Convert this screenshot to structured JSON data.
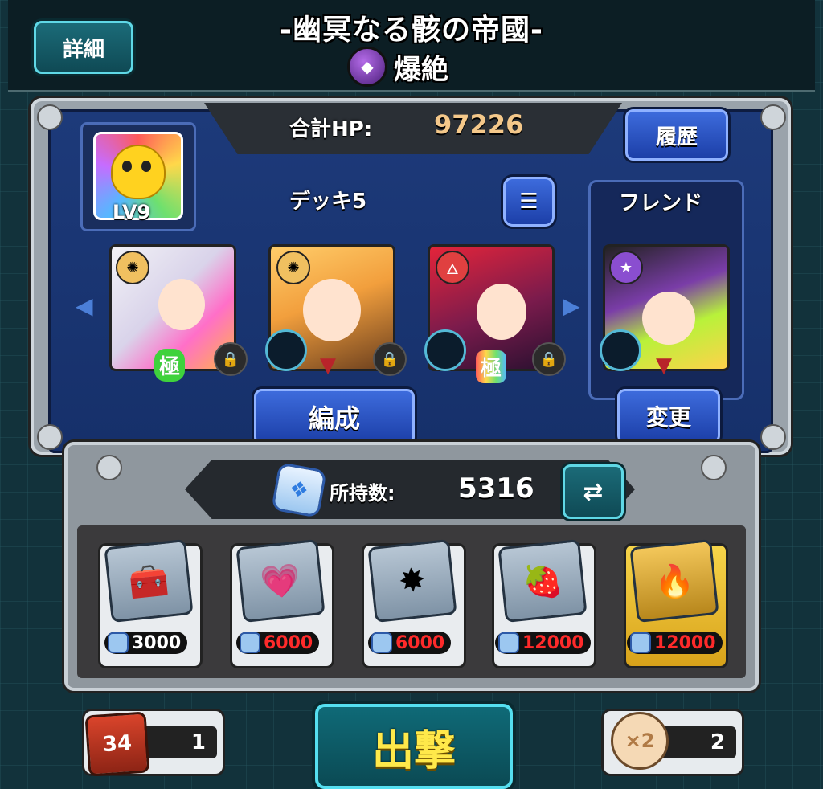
{
  "header": {
    "title": "-幽冥なる骸の帝國-",
    "difficulty_label": "爆絶",
    "detail_button": "詳細"
  },
  "deck": {
    "total_hp_label": "合計HP:",
    "total_hp_value": "97226",
    "history_button": "履歴",
    "deck_label": "デッキ5",
    "friend_label": "フレンド",
    "player_level": "LV9",
    "edit_button": "編成",
    "change_button": "変更",
    "kiwami_badge": "極"
  },
  "shop": {
    "owned_label": "所持数:",
    "owned_value": "5316",
    "items": [
      {
        "price": "3000",
        "price_color": "#ffffff"
      },
      {
        "price": "6000",
        "price_color": "#ff2a2a"
      },
      {
        "price": "6000",
        "price_color": "#ff2a2a"
      },
      {
        "price": "12000",
        "price_color": "#ff2a2a"
      },
      {
        "price": "12000",
        "price_color": "#ff2a2a"
      }
    ]
  },
  "footer": {
    "launch_button": "出撃",
    "dice_count": "1",
    "dice_face": "34",
    "coin_count": "2",
    "coin_mark": "×2"
  },
  "colors": {
    "accent_cyan": "#5fd8e6",
    "accent_blue": "#3d6bdc",
    "hp_gold": "#f4c88a"
  }
}
